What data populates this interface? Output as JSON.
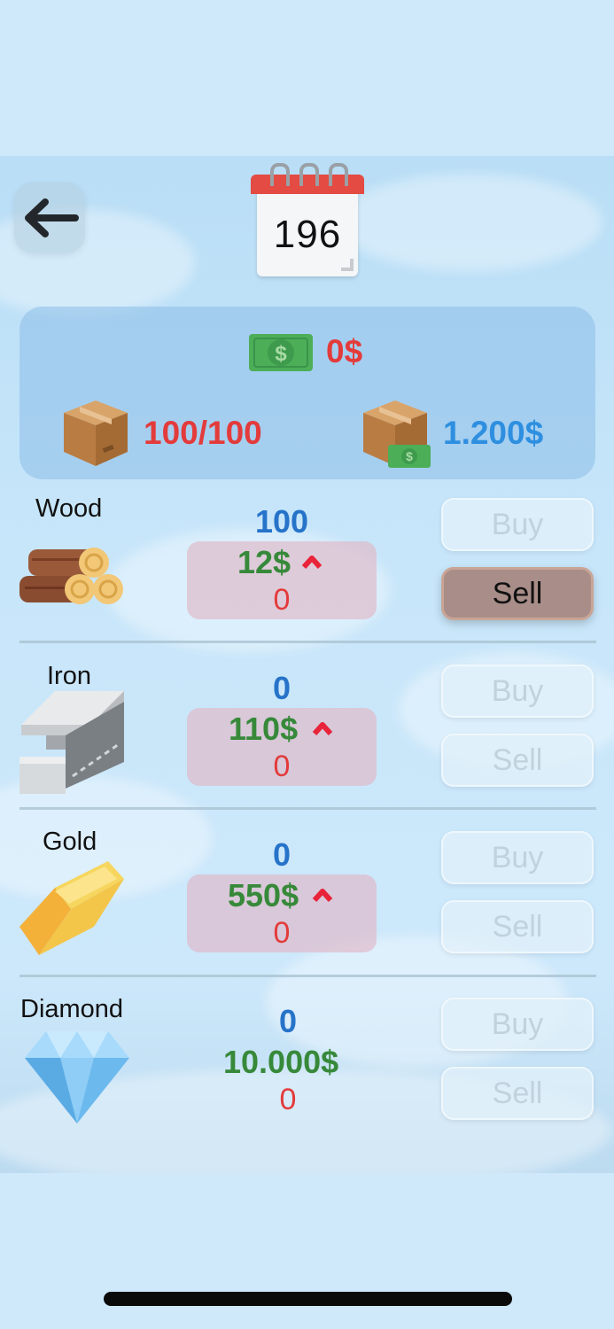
{
  "header": {
    "day": "196"
  },
  "summary": {
    "money": "0$",
    "capacity": "100/100",
    "storage_value": "1.200$"
  },
  "resources": [
    {
      "name": "Wood",
      "quantity": "100",
      "price": "12$",
      "owned": "0",
      "trend": "up",
      "buy": "Buy",
      "sell": "Sell",
      "sell_active": true
    },
    {
      "name": "Iron",
      "quantity": "0",
      "price": "110$",
      "owned": "0",
      "trend": "up",
      "buy": "Buy",
      "sell": "Sell",
      "sell_active": false
    },
    {
      "name": "Gold",
      "quantity": "0",
      "price": "550$",
      "owned": "0",
      "trend": "up",
      "buy": "Buy",
      "sell": "Sell",
      "sell_active": false
    },
    {
      "name": "Diamond",
      "quantity": "0",
      "price": "10.000$",
      "owned": "0",
      "trend": "none",
      "buy": "Buy",
      "sell": "Sell",
      "sell_active": false
    }
  ],
  "colors": {
    "price": "#37893a",
    "quantity": "#2673c9",
    "owned": "#e33b3b",
    "trend_up": "#e8233a"
  },
  "icons": [
    "back-arrow-icon",
    "calendar-icon",
    "money-icon",
    "box-icon",
    "box-money-icon",
    "wood-icon",
    "iron-icon",
    "gold-icon",
    "diamond-icon",
    "trend-up-icon"
  ]
}
